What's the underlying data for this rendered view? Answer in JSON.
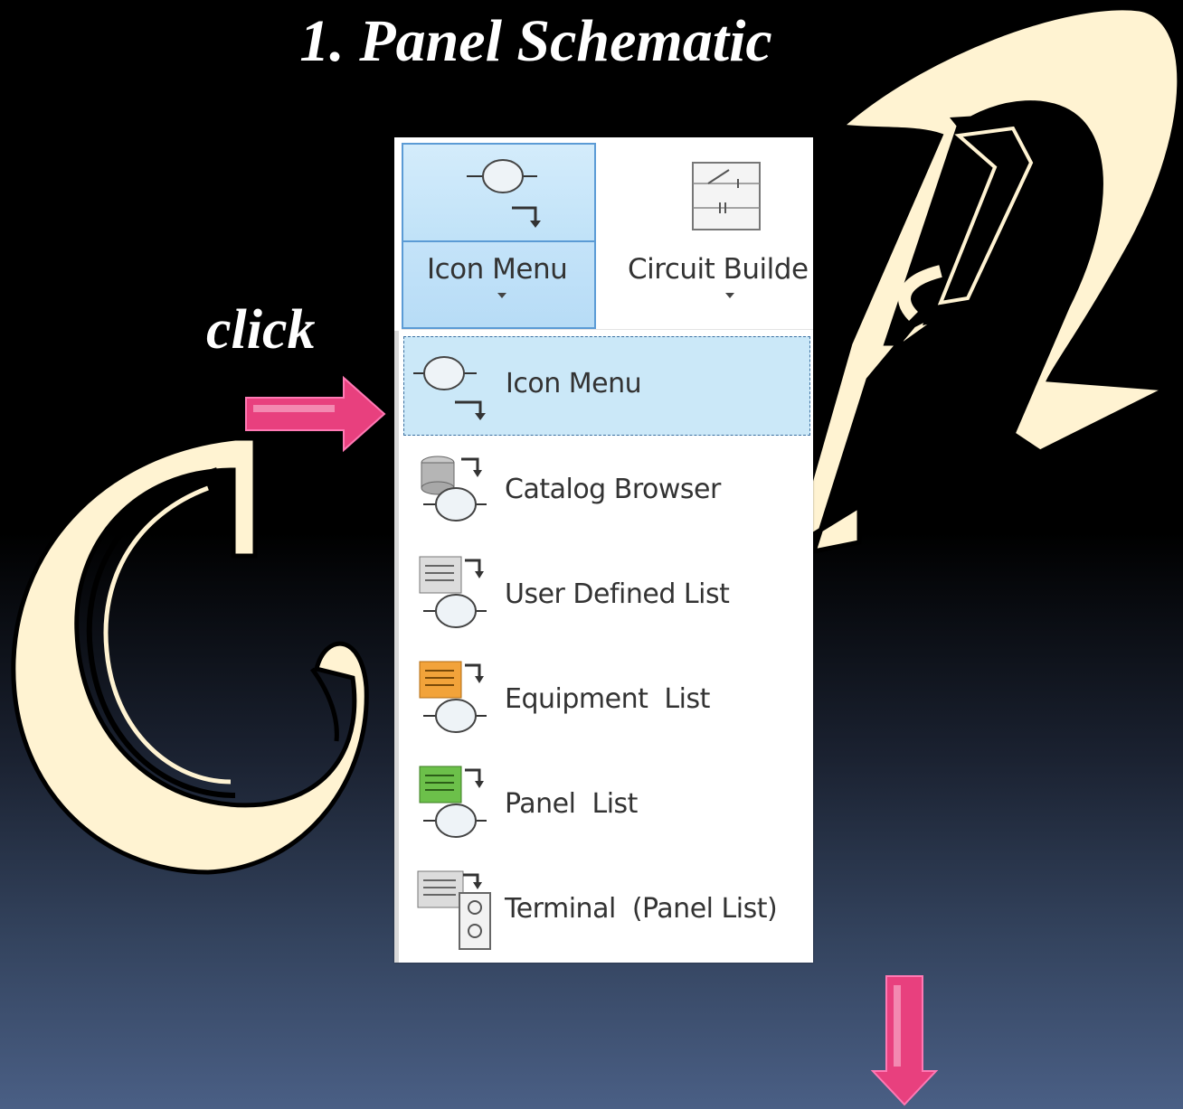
{
  "slide": {
    "title": "1. Panel Schematic",
    "click_label": "click"
  },
  "ribbon": {
    "icon_menu_label": "Icon Menu",
    "circuit_builder_label": "Circuit Builde"
  },
  "menu": {
    "items": [
      {
        "label": "Icon Menu",
        "icon": "icon-menu-icon",
        "selected": true
      },
      {
        "label": "Catalog Browser",
        "icon": "catalog-browser-icon"
      },
      {
        "label": "User Defined List",
        "icon": "user-defined-list-icon"
      },
      {
        "label": "Equipment  List",
        "icon": "equipment-list-icon"
      },
      {
        "label": "Panel  List",
        "icon": "panel-list-icon"
      },
      {
        "label": "Terminal  (Panel List)",
        "icon": "terminal-panel-list-icon"
      }
    ]
  },
  "colors": {
    "decor_letter_fill": "#fff3d2",
    "arrow_pink": "#e8407e",
    "selected_bg": "#cbe8f8",
    "selected_border": "#5b9bd5"
  }
}
